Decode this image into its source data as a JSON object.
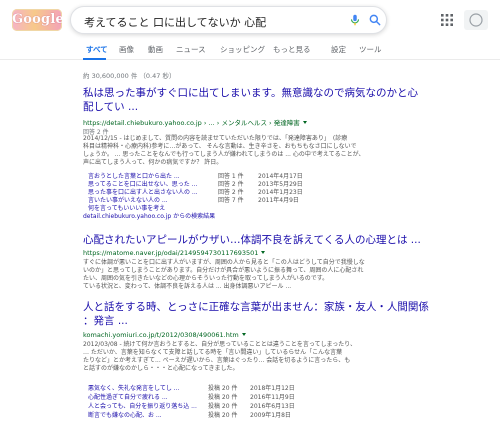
{
  "logo": {
    "text": "Google",
    "colors": [
      "#f6b3c7",
      "#f7c98a"
    ]
  },
  "search": {
    "query": "考えてること 口に出してないか 心配"
  },
  "icons": {
    "mic": "mic-icon",
    "search": "search-icon",
    "apps": "apps-grid-icon",
    "account": "account-icon"
  },
  "tabs": [
    {
      "label": "すべて",
      "active": true
    },
    {
      "label": "画像"
    },
    {
      "label": "動画"
    },
    {
      "label": "ニュース"
    },
    {
      "label": "ショッピング"
    },
    {
      "label": "もっと見る"
    },
    {
      "label": "設定"
    },
    {
      "label": "ツール"
    }
  ],
  "stats": "約 30,600,000 件 （0.47 秒）",
  "results": [
    {
      "title_line1": "私は思った事がすぐ口に出てしまいます。無意識なので病気なのかと心",
      "title_line2": "配してい ...",
      "url": "https://detail.chiebukuro.yahoo.co.jp › ... › メンタルヘルス › 発達障害",
      "meta": "回答 2 件",
      "snippet": [
        "2014/12/15 - はじめまして、質問の内容を読ませていただいた限りでは、「発達障害あり」　(診療",
        "科目は精神科・心療内科)参考に…があって、 そんな言動は、生き辛さを、おもちもなさ口にしないで",
        "しょうか。 ... 思ったことをなんでも行ってしまう人が嫌われてしまうのは ... 心の中で考えてることが、",
        "声に出てしまう人って、何かの病気ですか？ 許日。"
      ],
      "subresults": [
        {
          "title": "言おうとした言葉と口から出た ...",
          "count": "回答 1 件",
          "date": "2014年4月17日"
        },
        {
          "title": "思ってることを口に出せない、思った ...",
          "count": "回答 2 件",
          "date": "2013年5月29日"
        },
        {
          "title": "思った事を口に出す人と出さない人の ...",
          "count": "回答 2 件",
          "date": "2014年1月23日"
        },
        {
          "title": "言いたい事がいえない人の ...",
          "count": "回答 7 件",
          "date": "2011年4月9日"
        },
        {
          "title": "何を言ってもいいい事を考え"
        }
      ],
      "more": "detail.chiebukuro.yahoo.co.jp からの検索結果"
    },
    {
      "title_line1": "心配されたいアピールがウザい…体調不良を訴えてくる人の心理とは ...",
      "url": "https://matome.naver.jp/odai/2149594730117693501",
      "snippet": [
        "すぐに体調が悪いことを口に出す人がいますが、周囲の人から見ると「この人はどうして自分で我慢しな",
        "いのか」と思ってしまうことがあります。自分だけが具合が悪いように振る舞って、周囲の人に心配され",
        "たい、周囲の気を引きたいなどの心理からそういった行動を取ってしまう人がいるのです。",
        "ている状況と、変わって、体調不良を訴える人は ... 出身体調悪いアピール ..."
      ]
    },
    {
      "title_line1": "人と話をする時、とっさに正確な言葉が出ません：家族・友人・人間関係",
      "title_line2": "：発言 ...",
      "url": "komachi.yomiuri.co.jp/t/2012/0308/490061.htm",
      "snippet": [
        "2012/03/08 - 続けて何か言おうとすると、自分が思っていることとは違うことを言ってしまったり、",
        "… ただいか、言葉を知らなくて支障と話してる時を「言い間違い」しているらせん「こんな言葉",
        "たりなど」とか考えすぎて... ぺーえが遅いから、言葉はぐったり... 会話を切るように言ったら、も",
        "と話すのが嫌なのかしら・・・と心配になってきました。"
      ],
      "subresults": [
        {
          "title": "悪気なく、失礼な発言をしてし ...",
          "count": "投稿 20 件",
          "date": "2018年1月12日"
        },
        {
          "title": "心配性過ぎて自分で疲れる ...",
          "count": "投稿 20 件",
          "date": "2016年11月9日"
        },
        {
          "title": "人と会っても、自分を振り返り落ち込 ...",
          "count": "投稿 20 件",
          "date": "2016年6月13日"
        },
        {
          "title": "断言でも嫌なの心配、お ...",
          "count": "投稿 20 件",
          "date": "2009年1月8日"
        }
      ]
    }
  ]
}
